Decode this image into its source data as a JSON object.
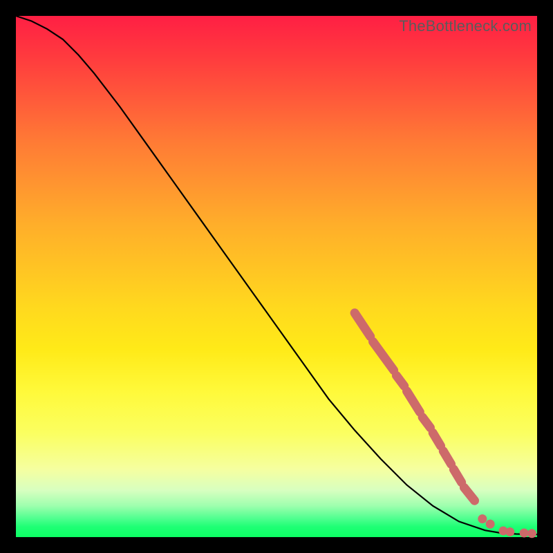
{
  "watermark": "TheBottleneck.com",
  "chart_data": {
    "type": "line",
    "title": "",
    "xlabel": "",
    "ylabel": "",
    "xlim": [
      0,
      100
    ],
    "ylim": [
      0,
      100
    ],
    "curve": [
      {
        "x": 0,
        "y": 100
      },
      {
        "x": 3,
        "y": 99
      },
      {
        "x": 6,
        "y": 97.5
      },
      {
        "x": 9,
        "y": 95.5
      },
      {
        "x": 12,
        "y": 92.5
      },
      {
        "x": 15,
        "y": 89
      },
      {
        "x": 20,
        "y": 82.5
      },
      {
        "x": 25,
        "y": 75.5
      },
      {
        "x": 30,
        "y": 68.5
      },
      {
        "x": 35,
        "y": 61.5
      },
      {
        "x": 40,
        "y": 54.5
      },
      {
        "x": 45,
        "y": 47.5
      },
      {
        "x": 50,
        "y": 40.5
      },
      {
        "x": 55,
        "y": 33.5
      },
      {
        "x": 60,
        "y": 26.5
      },
      {
        "x": 65,
        "y": 20.5
      },
      {
        "x": 70,
        "y": 15
      },
      {
        "x": 75,
        "y": 10
      },
      {
        "x": 80,
        "y": 6
      },
      {
        "x": 85,
        "y": 3
      },
      {
        "x": 90,
        "y": 1.3
      },
      {
        "x": 93,
        "y": 0.8
      },
      {
        "x": 96,
        "y": 0.6
      },
      {
        "x": 100,
        "y": 0.5
      }
    ],
    "marker_segments": [
      {
        "from": {
          "x": 65,
          "y": 43
        },
        "to": {
          "x": 68,
          "y": 38.5
        }
      },
      {
        "from": {
          "x": 68.5,
          "y": 37.5
        },
        "to": {
          "x": 72.5,
          "y": 32
        }
      },
      {
        "from": {
          "x": 73,
          "y": 31
        },
        "to": {
          "x": 74.5,
          "y": 29
        }
      },
      {
        "from": {
          "x": 75,
          "y": 28
        },
        "to": {
          "x": 77.5,
          "y": 24
        }
      },
      {
        "from": {
          "x": 78,
          "y": 23
        },
        "to": {
          "x": 79.5,
          "y": 21
        }
      },
      {
        "from": {
          "x": 80,
          "y": 20
        },
        "to": {
          "x": 81.5,
          "y": 17.5
        }
      },
      {
        "from": {
          "x": 82,
          "y": 16.5
        },
        "to": {
          "x": 83.5,
          "y": 14
        }
      },
      {
        "from": {
          "x": 84,
          "y": 13
        },
        "to": {
          "x": 85.5,
          "y": 10.5
        }
      },
      {
        "from": {
          "x": 86,
          "y": 9.5
        },
        "to": {
          "x": 88,
          "y": 7
        }
      }
    ],
    "marker_dots": [
      {
        "x": 89.5,
        "y": 3.5
      },
      {
        "x": 91,
        "y": 2.5
      },
      {
        "x": 93.5,
        "y": 1.2
      },
      {
        "x": 94.8,
        "y": 1.0
      },
      {
        "x": 97.5,
        "y": 0.8
      },
      {
        "x": 99,
        "y": 0.7
      }
    ]
  }
}
